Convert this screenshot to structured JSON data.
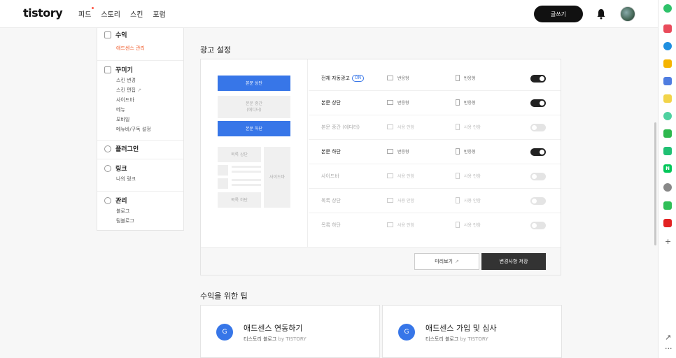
{
  "header": {
    "logo": "tistory",
    "nav": [
      "피드",
      "스토리",
      "스킨",
      "포럼"
    ],
    "write_label": "글쓰기"
  },
  "sidebar": {
    "sections": [
      {
        "title": "수익",
        "items": [
          "애드센스 관리"
        ]
      },
      {
        "title": "꾸미기",
        "items": [
          "스킨 변경",
          "스킨 편집",
          "사이드바",
          "메뉴",
          "모바일",
          "메뉴바/구독 설정"
        ]
      },
      {
        "title": "플러그인",
        "items": []
      },
      {
        "title": "링크",
        "items": [
          "나의 링크"
        ]
      },
      {
        "title": "관리",
        "items": [
          "블로그",
          "팀블로그"
        ]
      }
    ]
  },
  "ad_settings": {
    "title": "광고 설정",
    "preview": {
      "top": "본문 상단",
      "mid_1": "본문 중간",
      "mid_2": "(에디터)",
      "bottom": "본문 하단",
      "list_top": "목록 상단",
      "list_bottom": "목록 하단",
      "sidebar": "사이드바"
    },
    "rows": [
      {
        "label": "전체 자동광고",
        "badge": "ON",
        "opt1": "반응형",
        "opt2": "반응형",
        "on": true
      },
      {
        "label": "본문 상단",
        "opt1": "반응형",
        "opt2": "반응형",
        "on": true
      },
      {
        "label": "본문 중간 (에디터)",
        "opt1": "사용 안함",
        "opt2": "사용 안함",
        "on": false
      },
      {
        "label": "본문 하단",
        "opt1": "반응형",
        "opt2": "반응형",
        "on": true
      },
      {
        "label": "사이드바",
        "opt1": "사용 안함",
        "opt2": "사용 안함",
        "on": false
      },
      {
        "label": "목록 상단",
        "opt1": "사용 안함",
        "opt2": "사용 안함",
        "on": false
      },
      {
        "label": "목록 하단",
        "opt1": "사용 안함",
        "opt2": "사용 안함",
        "on": false
      }
    ],
    "preview_button": "미리보기",
    "save_button": "변경사항 저장"
  },
  "tips": {
    "title": "수익을 위한 팁",
    "cards": [
      {
        "icon": "G",
        "title": "애드센스 연동하기",
        "source": "티스토리 블로그",
        "by": "by TISTORY"
      },
      {
        "icon": "G",
        "title": "애드센스 가입 및 심사",
        "source": "티스토리 블로그",
        "by": "by TISTORY"
      }
    ]
  },
  "colors": {
    "accent": "#3776e8",
    "active_menu": "#f05a28",
    "toggle_on": "#222222"
  },
  "extensions": [
    "green-circle",
    "red-pocket",
    "blue-edge",
    "yellow-star",
    "blue-mail",
    "yellow-note",
    "green-play",
    "green-chat",
    "green-bot",
    "naver-n",
    "github",
    "green-msg",
    "red-brand"
  ]
}
